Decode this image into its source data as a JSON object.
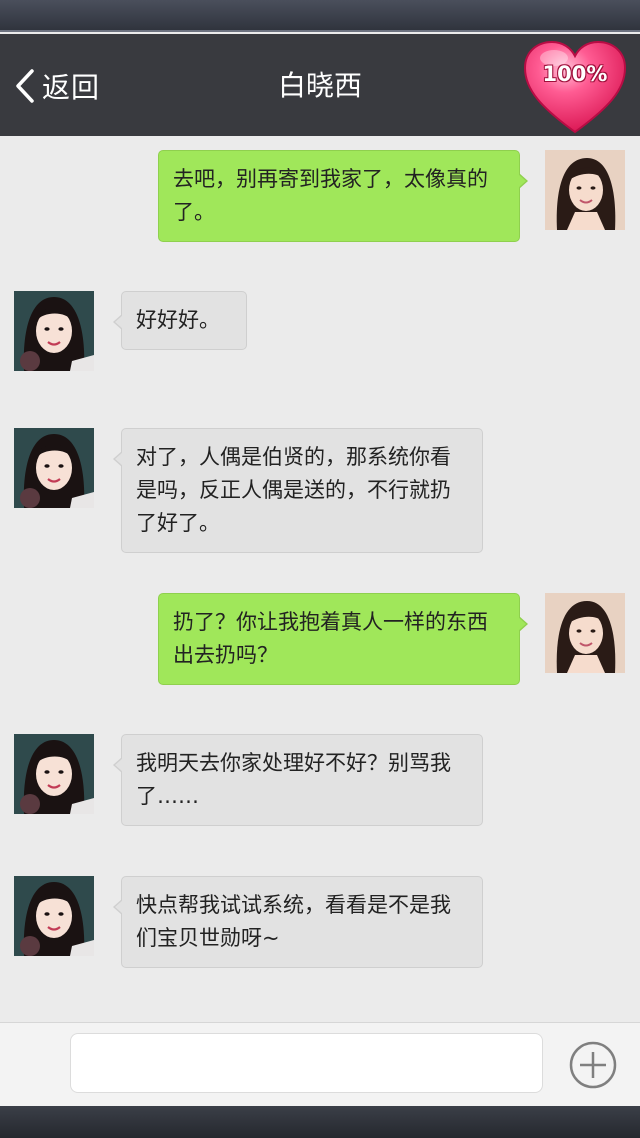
{
  "header": {
    "back_label": "返回",
    "title": "白晓西",
    "affection_percent": "100%"
  },
  "messages": [
    {
      "side": "right",
      "text": "去吧，别再寄到我家了，太像真的了。"
    },
    {
      "side": "left",
      "text": "好好好。"
    },
    {
      "side": "left",
      "text": "对了，人偶是伯贤的，那系统你看是吗，反正人偶是送的，不行就扔了好了。"
    },
    {
      "side": "right",
      "text": "扔了？你让我抱着真人一样的东西出去扔吗？"
    },
    {
      "side": "left",
      "text": "我明天去你家处理好不好？别骂我了……"
    },
    {
      "side": "left",
      "text": "快点帮我试试系统，看看是不是我们宝贝世勋呀~"
    }
  ],
  "composer": {
    "input_value": "",
    "plus_icon": "plus-circle-icon"
  },
  "colors": {
    "nav_bg": "#393a3f",
    "chat_bg": "#ebebeb",
    "sent_bubble": "#a0e75a",
    "received_bubble": "#e2e2e2",
    "heart": "#ff3f7a"
  }
}
